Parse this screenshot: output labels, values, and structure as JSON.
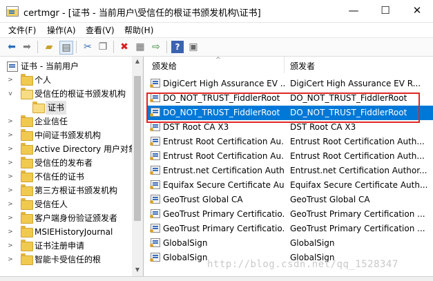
{
  "window": {
    "title": "certmgr - [证书 - 当前用户\\受信任的根证书颁发机构\\证书]",
    "minimize": "—",
    "maximize": "☐",
    "close": "✕"
  },
  "menu": [
    "文件(F)",
    "操作(A)",
    "查看(V)",
    "帮助(H)"
  ],
  "tree": {
    "root": "证书 - 当前用户",
    "items": [
      {
        "label": "个人",
        "expanded": false
      },
      {
        "label": "受信任的根证书颁发机构",
        "expanded": true
      },
      {
        "label": "证书",
        "child": true,
        "selected": true
      },
      {
        "label": "企业信任",
        "expanded": false
      },
      {
        "label": "中间证书颁发机构",
        "expanded": false
      },
      {
        "label": "Active Directory 用户对象",
        "expanded": false
      },
      {
        "label": "受信任的发布者",
        "expanded": false
      },
      {
        "label": "不信任的证书",
        "expanded": false
      },
      {
        "label": "第三方根证书颁发机构",
        "expanded": false
      },
      {
        "label": "受信任人",
        "expanded": false
      },
      {
        "label": "客户端身份验证颁发者",
        "expanded": false
      },
      {
        "label": "MSIEHistoryJournal",
        "expanded": false
      },
      {
        "label": "证书注册申请",
        "expanded": false
      },
      {
        "label": "智能卡受信任的根",
        "expanded": false
      }
    ]
  },
  "list": {
    "columns": [
      "颁发给",
      "颁发者"
    ],
    "rows": [
      {
        "issued_to": "DigiCert High Assurance EV ...",
        "issued_by": "DigiCert High Assurance EV R..."
      },
      {
        "issued_to": "DO_NOT_TRUST_FiddlerRoot",
        "issued_by": "DO_NOT_TRUST_FiddlerRoot"
      },
      {
        "issued_to": "DO_NOT_TRUST_FiddlerRoot",
        "issued_by": "DO_NOT_TRUST_FiddlerRoot",
        "selected": true
      },
      {
        "issued_to": "DST Root CA X3",
        "issued_by": "DST Root CA X3"
      },
      {
        "issued_to": "Entrust Root Certification Au...",
        "issued_by": "Entrust Root Certification Auth..."
      },
      {
        "issued_to": "Entrust Root Certification Au...",
        "issued_by": "Entrust Root Certification Auth..."
      },
      {
        "issued_to": "Entrust.net Certification Auth...",
        "issued_by": "Entrust.net Certification Author..."
      },
      {
        "issued_to": "Equifax Secure Certificate Au...",
        "issued_by": "Equifax Secure Certificate Auth..."
      },
      {
        "issued_to": "GeoTrust Global CA",
        "issued_by": "GeoTrust Global CA"
      },
      {
        "issued_to": "GeoTrust Primary Certificatio...",
        "issued_by": "GeoTrust Primary Certification ..."
      },
      {
        "issued_to": "GeoTrust Primary Certificatio...",
        "issued_by": "GeoTrust Primary Certification ..."
      },
      {
        "issued_to": "GlobalSign",
        "issued_by": "GlobalSign"
      },
      {
        "issued_to": "GlobalSign",
        "issued_by": "GlobalSign"
      }
    ]
  },
  "watermark": "http://blog.csdn.net/qq_1528347",
  "colors": {
    "selection": "#0078d7",
    "highlight_box": "#e02424"
  }
}
